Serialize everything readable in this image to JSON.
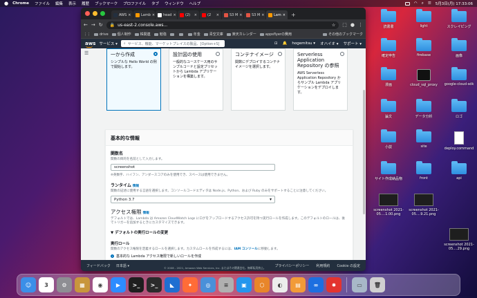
{
  "menubar": {
    "app": "Chrome",
    "items": [
      "ファイル",
      "編集",
      "表示",
      "履歴",
      "ブックマーク",
      "プロファイル",
      "タブ",
      "ウィンドウ",
      "ヘルプ"
    ],
    "clock": "5月3日(月) 17:33:06"
  },
  "browser": {
    "tabs": [
      {
        "label": "AWS",
        "color": "#232f3e"
      },
      {
        "label": "Lamb",
        "color": "#ff9900"
      },
      {
        "label": "head",
        "color": "#ffffff"
      },
      {
        "label": "(2)",
        "color": "#ff0000"
      },
      {
        "label": "(2",
        "color": "#ff0000"
      },
      {
        "label": "S3 M",
        "color": "#e25444"
      },
      {
        "label": "S3 M",
        "color": "#e25444"
      },
      {
        "label": "Lam",
        "color": "#ff9900"
      }
    ],
    "url": "us-east-2.console.aws...",
    "bookmarks": [
      "drive",
      "個人制作",
      "株関連",
      "勉強",
      "",
      "",
      "年金",
      "青空文庫",
      "楽天カレンダー",
      "appsflyerの費用"
    ],
    "bookmarks_other": "その他のブックマーク"
  },
  "aws": {
    "logo": "aws",
    "services": "サービス",
    "search_placeholder": "サービス、機能、マーケットプレイスの製品、[Option+S]",
    "user": "hogemitsu",
    "region": "オハイオ",
    "support": "サポート"
  },
  "cards": [
    {
      "title": "一から作成",
      "desc": "シンプルな Hello World の例で開始します。",
      "selected": true
    },
    {
      "title": "設計図の使用",
      "desc": "一般的なユースケース用のサンプルコードと設定プリセットから Lambda アプリケーションを構築します。",
      "selected": false
    },
    {
      "title": "コンテナイメージ",
      "desc": "関数にデプロイするコンテナイメージを選択します。",
      "selected": false
    },
    {
      "title": "Serverless Application Repository の参照",
      "desc": "AWS Serverless Application Repository からサンプル Lambda アプリケーションをデプロイします。",
      "selected": false
    }
  ],
  "basic_info": {
    "title": "基本的な情報",
    "fn_label": "関数名",
    "fn_desc": "関数の目的を名前として入力します。",
    "fn_value": "screenshot",
    "fn_hint": "※英数字、ハイフン、アンダースコアのみを使用でき、スペースは使用できません。",
    "runtime_label": "ランタイム",
    "info": "情報",
    "runtime_desc": "関数の記述に使用する言語を選択します。コンソールコードエディタは Node.js、Python、および Ruby のみをサポートすることに注意してください。",
    "runtime_value": "Python 3.7",
    "perm_title": "アクセス権限",
    "perm_desc": "デフォルトでは、Lambda は Amazon CloudWatch Logs にログをアップロードするアクセス許可を持つ実行ロールを作成します。このデフォルトのロールは、後でトリガーを追加するときにカスタマイズできます。",
    "expander": "デフォルトの実行ロールの変更",
    "role_title": "実行ロール",
    "role_desc_a": "関数のアクセス権限を定義するロールを選択します。カスタムロールを作成するには、",
    "role_link": "IAM コンソール",
    "role_desc_b": "に移動します。",
    "role_option": "基本的な Lambda アクセス権限で新しいロールを作成"
  },
  "footer": {
    "feedback": "フィードバック",
    "lang": "日本語",
    "copy": "© 2008 - 2021, Amazon Web Services, Inc. またはその関連会社。無断転用禁止。",
    "privacy": "プライバシーポリシー",
    "terms": "利用規約",
    "cookie": "Cookie の設定"
  },
  "desktop": [
    {
      "label": "読書書",
      "kind": "folder"
    },
    {
      "label": "light",
      "kind": "folder"
    },
    {
      "label": "スクレイピング",
      "kind": "folder"
    },
    {
      "label": "確定申告",
      "kind": "folder"
    },
    {
      "label": "firebase",
      "kind": "folder"
    },
    {
      "label": "画像",
      "kind": "folder"
    },
    {
      "label": "漫画",
      "kind": "folder"
    },
    {
      "label": "cloud_sql_proxy",
      "kind": "terminal"
    },
    {
      "label": "google-cloud-sdk",
      "kind": "folder"
    },
    {
      "label": "論文",
      "kind": "folder"
    },
    {
      "label": "データ分析",
      "kind": "folder"
    },
    {
      "label": "ロゴ",
      "kind": "folder"
    },
    {
      "label": "小説",
      "kind": "folder"
    },
    {
      "label": "site",
      "kind": "folder"
    },
    {
      "label": "deploy.command",
      "kind": "doc"
    },
    {
      "label": "サイト作成納品物",
      "kind": "folder"
    },
    {
      "label": "front",
      "kind": "folder"
    },
    {
      "label": "api",
      "kind": "folder"
    },
    {
      "label": "screenshot 2021-05....1.00.png",
      "kind": "thumb"
    },
    {
      "label": "screenshot 2021-05....9.21.png",
      "kind": "thumb"
    },
    {
      "label": "screenshot 2021-05....29.png",
      "kind": "thumb"
    }
  ],
  "dock": [
    {
      "name": "finder",
      "color": "#3b8fe8",
      "glyph": "☺"
    },
    {
      "name": "calendar",
      "color": "#ffffff",
      "glyph": "3"
    },
    {
      "name": "system-preferences",
      "color": "#8e8e93",
      "glyph": "⚙"
    },
    {
      "name": "archive",
      "color": "#c8963c",
      "glyph": "▦"
    },
    {
      "name": "chrome",
      "color": "#ffffff",
      "glyph": "◉"
    },
    {
      "name": "zoom",
      "color": "#2d8cff",
      "glyph": "▶"
    },
    {
      "name": "terminal",
      "color": "#1e1e1e",
      "glyph": ">_"
    },
    {
      "name": "terminal-2",
      "color": "#2b2b2b",
      "glyph": ">_"
    },
    {
      "name": "vscode",
      "color": "#1f6fd1",
      "glyph": "◣"
    },
    {
      "name": "postman",
      "color": "#ff6c37",
      "glyph": "✦"
    },
    {
      "name": "magnifier",
      "color": "#4a90d9",
      "glyph": "◎"
    },
    {
      "name": "sequel",
      "color": "#b0b0b0",
      "glyph": "≡"
    },
    {
      "name": "docker",
      "color": "#2496ed",
      "glyph": "▣"
    },
    {
      "name": "sourcetree",
      "color": "#e8862a",
      "glyph": "⬡"
    },
    {
      "name": "figma",
      "color": "#ececec",
      "glyph": "◐"
    },
    {
      "name": "photos",
      "color": "#f29b38",
      "glyph": "▤"
    },
    {
      "name": "infinity",
      "color": "#1d6fe0",
      "glyph": "∞"
    },
    {
      "name": "pdf-tool",
      "color": "#e3342f",
      "glyph": "✸"
    },
    {
      "name": "preview",
      "color": "#a8b8c8",
      "glyph": "▭"
    },
    {
      "name": "trash",
      "color": "#d0d0d0",
      "glyph": "🗑"
    }
  ]
}
